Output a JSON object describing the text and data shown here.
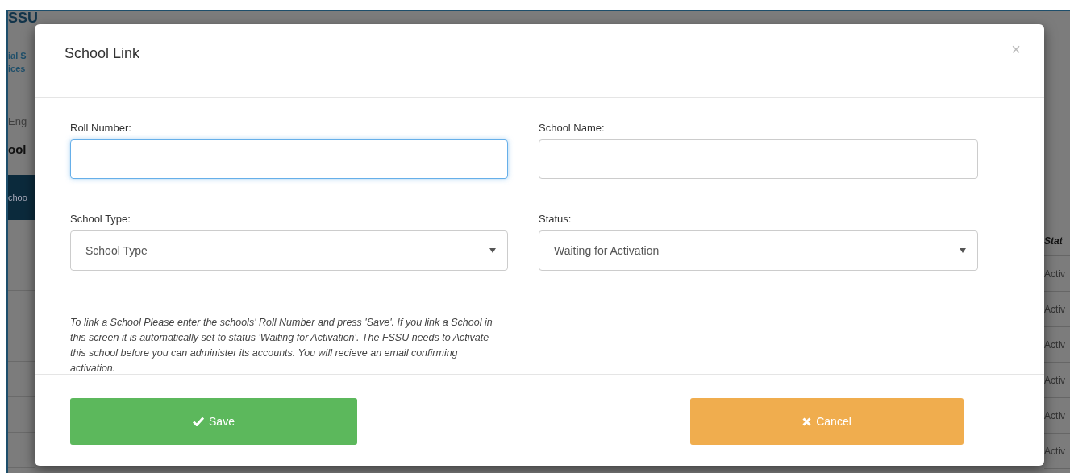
{
  "background": {
    "logo": "SSU",
    "logo_lines": [
      "ial S",
      "ices"
    ],
    "language": "Eng",
    "heading": "ool",
    "nav_item": "choo",
    "table_header": "Stat",
    "status_cells": [
      "Activ",
      "Activ",
      "Activ",
      "Activ",
      "Activ",
      "Activ"
    ]
  },
  "modal": {
    "title": "School Link",
    "close": "×",
    "fields": [
      {
        "kind": "input",
        "label": "Roll Number:",
        "focused": true
      },
      {
        "kind": "input",
        "label": "School Name:",
        "focused": false
      },
      {
        "kind": "select",
        "label": "School Type:",
        "value": "School Type",
        "focused": false
      },
      {
        "kind": "select",
        "label": "Status:",
        "value": "Waiting for Activation",
        "focused": false
      }
    ],
    "help": "To link a School Please enter the schools' Roll Number and press 'Save'. If you link a School in this screen it is automatically set to status 'Waiting for Activation'. The FSSU needs to Activate this school before you can administer its accounts. You will recieve an email confirming activation.",
    "buttons": [
      {
        "kind": "save",
        "label": "Save"
      },
      {
        "kind": "cancel",
        "label": "Cancel"
      }
    ]
  }
}
